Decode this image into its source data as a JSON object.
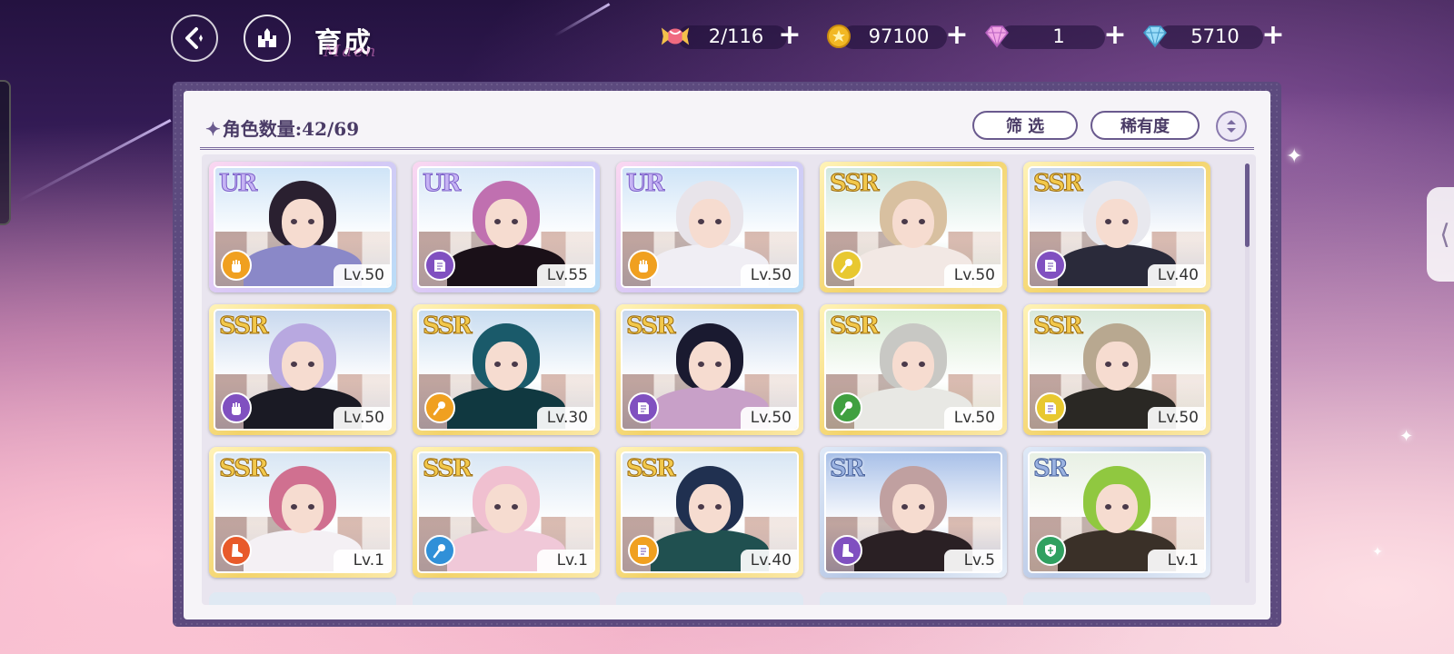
{
  "header": {
    "title": "育成",
    "title_deco": "Maen"
  },
  "resources": [
    {
      "name": "candy",
      "icon": "candy-icon",
      "value": "2/116",
      "color": "#e6506e"
    },
    {
      "name": "gold-coin",
      "icon": "gold-coin-icon",
      "value": "97100",
      "color": "#f2b824"
    },
    {
      "name": "pink-diamond",
      "icon": "pink-diamond-icon",
      "value": "1",
      "color": "#e88ad8"
    },
    {
      "name": "blue-diamond",
      "icon": "blue-diamond-icon",
      "value": "5710",
      "color": "#6fc6f2"
    }
  ],
  "panel": {
    "count_label": "角色数量:42/69",
    "filter_label": "筛 选",
    "rarity_label": "稀有度"
  },
  "cards": [
    {
      "rarity": "UR",
      "level": "Lv.50",
      "element": "fist",
      "element_color": "#f0a020",
      "hair": "#2a2030",
      "body": "#8a88c8",
      "sky": "#cfe4f7"
    },
    {
      "rarity": "UR",
      "level": "Lv.55",
      "element": "book",
      "element_color": "#8050c0",
      "hair": "#c070b0",
      "body": "#1a1018",
      "sky": "#d8e8f8"
    },
    {
      "rarity": "UR",
      "level": "Lv.50",
      "element": "fist",
      "element_color": "#f0a020",
      "hair": "#e8e4ea",
      "body": "#f0eef4",
      "sky": "#cfe4f7"
    },
    {
      "rarity": "SSR",
      "level": "Lv.50",
      "element": "wand",
      "element_color": "#e8c830",
      "hair": "#d8c0a0",
      "body": "#f2e8e4",
      "sky": "#d0e8e0"
    },
    {
      "rarity": "SSR",
      "level": "Lv.40",
      "element": "book",
      "element_color": "#8050c0",
      "hair": "#e8e8ee",
      "body": "#2a2a3a",
      "sky": "#c8d8ee"
    },
    {
      "rarity": "SSR",
      "level": "Lv.50",
      "element": "fist",
      "element_color": "#8050c0",
      "hair": "#b8a8e0",
      "body": "#1a1a24",
      "sky": "#c8d8ee"
    },
    {
      "rarity": "SSR",
      "level": "Lv.30",
      "element": "wand",
      "element_color": "#f0a020",
      "hair": "#1a5a6a",
      "body": "#103840",
      "sky": "#c8dcf0"
    },
    {
      "rarity": "SSR",
      "level": "Lv.50",
      "element": "book",
      "element_color": "#8050c0",
      "hair": "#1a1a30",
      "body": "#c8a0c8",
      "sky": "#c8d8ee"
    },
    {
      "rarity": "SSR",
      "level": "Lv.50",
      "element": "wand",
      "element_color": "#40a040",
      "hair": "#c8c8c4",
      "body": "#e8e8e4",
      "sky": "#d8ecd4"
    },
    {
      "rarity": "SSR",
      "level": "Lv.50",
      "element": "book",
      "element_color": "#e8c830",
      "hair": "#b8a890",
      "body": "#2a2824",
      "sky": "#d8e8dc"
    },
    {
      "rarity": "SSR",
      "level": "Lv.1",
      "element": "boot",
      "element_color": "#e85a2a",
      "hair": "#d07090",
      "body": "#f4f0f4",
      "sky": "#d8e6f4"
    },
    {
      "rarity": "SSR",
      "level": "Lv.1",
      "element": "wand",
      "element_color": "#3090d8",
      "hair": "#f0c0d0",
      "body": "#f0c8d8",
      "sky": "#d8e6f4"
    },
    {
      "rarity": "SSR",
      "level": "Lv.40",
      "element": "book",
      "element_color": "#f0a020",
      "hair": "#203050",
      "body": "#205050",
      "sky": "#d8e6f4"
    },
    {
      "rarity": "SR",
      "level": "Lv.5",
      "element": "boot",
      "element_color": "#8050c0",
      "hair": "#c0a0a0",
      "body": "#2a2024",
      "sky": "#a8c0e8"
    },
    {
      "rarity": "SR",
      "level": "Lv.1",
      "element": "shield",
      "element_color": "#30a060",
      "hair": "#90c840",
      "body": "#3a3028",
      "sky": "#e8f0e4"
    }
  ]
}
